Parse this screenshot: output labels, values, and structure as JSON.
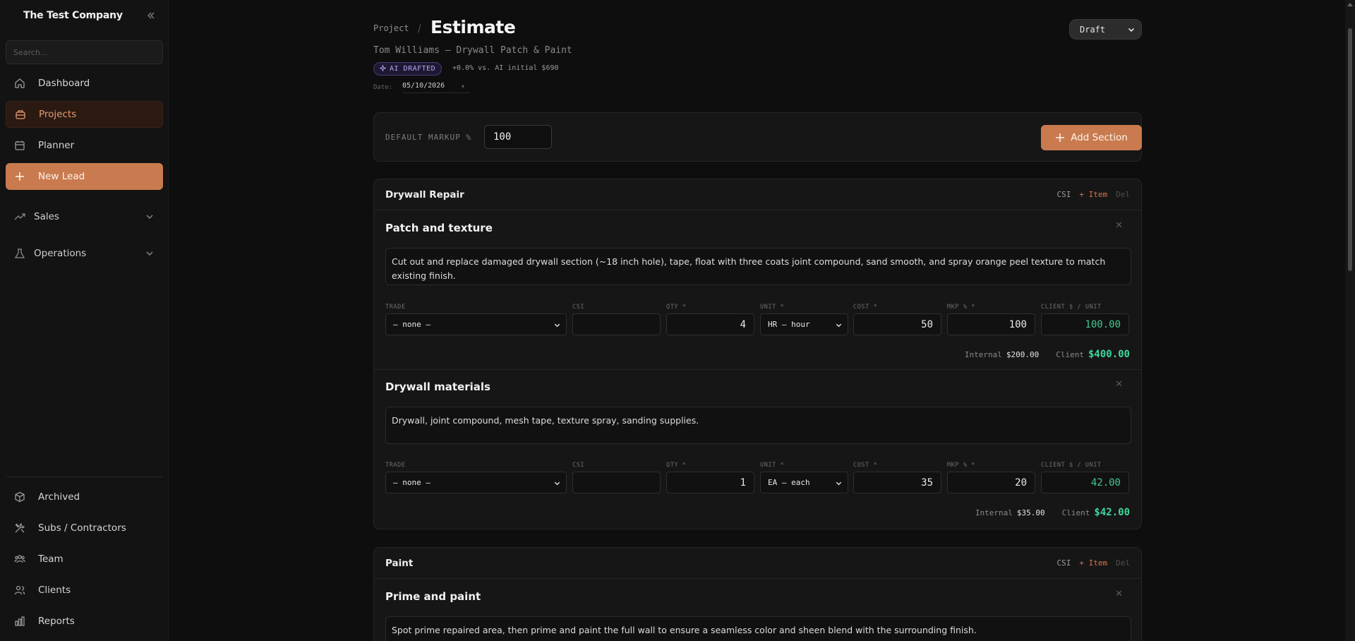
{
  "sidebar": {
    "brand": "The Test Company",
    "search_placeholder": "Search...",
    "items": [
      {
        "label": "Dashboard",
        "icon": "home-icon"
      },
      {
        "label": "Projects",
        "icon": "briefcase-icon"
      },
      {
        "label": "Planner",
        "icon": "calendar-icon"
      },
      {
        "label": "New Lead",
        "icon": "plus-icon"
      }
    ],
    "groups": [
      {
        "label": "Sales",
        "icon": "trend-icon"
      },
      {
        "label": "Operations",
        "icon": "flask-icon"
      }
    ],
    "bottom_items": [
      {
        "label": "Archived",
        "icon": "box-icon"
      },
      {
        "label": "Subs / Contractors",
        "icon": "tools-icon"
      },
      {
        "label": "Team",
        "icon": "team-icon"
      },
      {
        "label": "Clients",
        "icon": "clients-icon"
      },
      {
        "label": "Reports",
        "icon": "bar-chart-icon"
      }
    ]
  },
  "header": {
    "breadcrumb": "Project",
    "separator": "/",
    "title": "Estimate",
    "subtitle": "Tom Williams — Drywall Patch & Paint",
    "ai_badge": "AI DRAFTED",
    "ai_delta": "+0.0% vs. AI initial $690",
    "date_label": "Date:",
    "date_value": "05/10/2026",
    "status": "Draft"
  },
  "markup": {
    "label": "DEFAULT MARKUP %",
    "value": "100",
    "add_section_label": "Add Section"
  },
  "field_labels": {
    "trade": "TRADE",
    "csi": "CSI",
    "qty": "QTY *",
    "unit": "UNIT *",
    "cost": "COST *",
    "mkp": "MKP % *",
    "client_unit": "CLIENT $ / UNIT",
    "internal": "Internal",
    "client": "Client"
  },
  "section_actions": {
    "csi": "CSI",
    "add_item": "+ Item",
    "del": "Del"
  },
  "sections": [
    {
      "title": "Drywall Repair",
      "items": [
        {
          "title": "Patch and texture",
          "description": "Cut out and replace damaged drywall section (~18 inch hole), tape, float with three coats joint compound, sand smooth, and spray orange peel texture to match existing finish.",
          "trade": "— none —",
          "csi": "",
          "qty": "4",
          "unit": "HR — hour",
          "cost": "50",
          "mkp": "100",
          "client_unit": "100.00",
          "internal_total": "$200.00",
          "client_total": "$400.00"
        },
        {
          "title": "Drywall materials",
          "description": "Drywall, joint compound, mesh tape, texture spray, sanding supplies.",
          "trade": "— none —",
          "csi": "",
          "qty": "1",
          "unit": "EA — each",
          "cost": "35",
          "mkp": "20",
          "client_unit": "42.00",
          "internal_total": "$35.00",
          "client_total": "$42.00"
        }
      ]
    },
    {
      "title": "Paint",
      "items": [
        {
          "title": "Prime and paint",
          "description": "Spot prime repaired area, then prime and paint the full wall to ensure a seamless color and sheen blend with the surrounding finish."
        }
      ]
    }
  ],
  "colors": {
    "accent": "#c97b4f",
    "accent_text": "#d8774a",
    "client_green": "#3fd69a",
    "ai_purple": "#b7a4f2"
  }
}
